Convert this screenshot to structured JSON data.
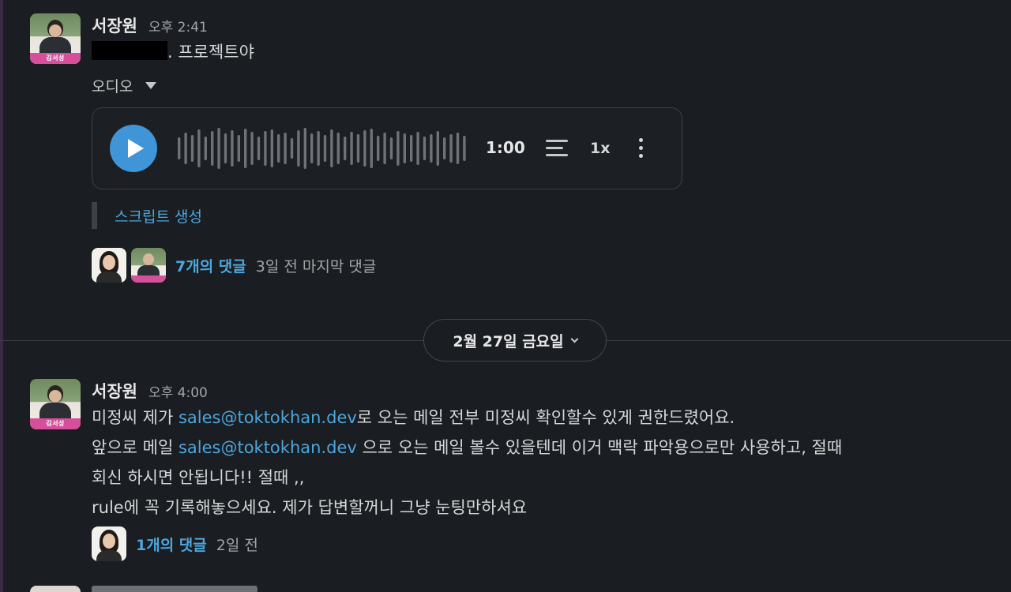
{
  "message1": {
    "sender": "서장원",
    "time": "오후 2:41",
    "avatar_banner": "김서성",
    "text_suffix": ". 프로젝트야",
    "audio": {
      "label": "오디오",
      "duration": "1:00",
      "speed": "1x"
    },
    "script_generate": "스크립트 생성",
    "thread": {
      "reply_count": "7개의 댓글",
      "last_reply": "3일 전 마지막 댓글"
    }
  },
  "date_divider": {
    "label": "2월 27일 금요일"
  },
  "message2": {
    "sender": "서장원",
    "time": "오후 4:00",
    "avatar_banner": "김서성",
    "line1_before": "미정씨 제가 ",
    "email": "sales@toktokhan.dev",
    "line1_after": "로 오는 메일 전부 미정씨 확인할수 있게 권한드렸어요.",
    "line2_before": "앞으로 메일 ",
    "line2_after": " 으로 오는 메일 볼수 있을텐데 이거 맥락 파악용으로만 사용하고, 절때",
    "line3": "회신 하시면 안됩니다!! 절때 ,,",
    "line4": "rule에 꼭 기록해놓으세요. 제가 답변할꺼니 그냥 눈팅만하셔요",
    "thread": {
      "reply_count": "1개의 댓글",
      "last_reply": "2일 전"
    }
  },
  "icons": {
    "play": "play-icon",
    "transcript": "transcript-icon",
    "more": "more-vertical-icon",
    "caret": "caret-down-icon"
  },
  "colors": {
    "background": "#1a1d21",
    "link": "#4ea6dc",
    "play_button": "#3f95d8"
  }
}
